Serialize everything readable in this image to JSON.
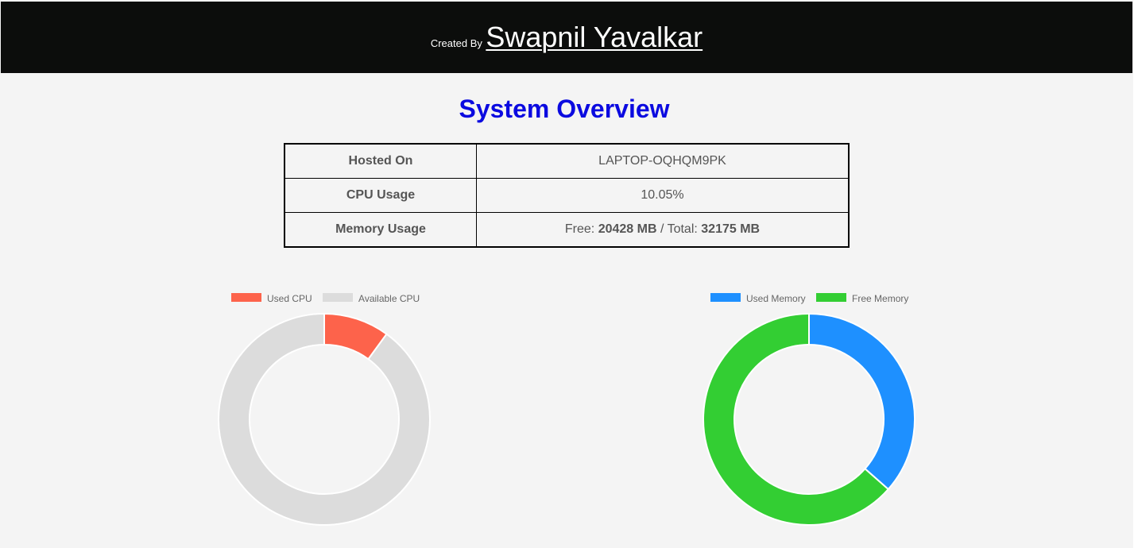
{
  "header": {
    "created_by": "Created By",
    "author": "Swapnil Yavalkar",
    "background": "#0c0d0c"
  },
  "page_title": "System Overview",
  "title_color": "#0b0ae0",
  "overview_table": {
    "rows": [
      {
        "label": "Hosted On",
        "value": "LAPTOP-OQHQM9PK"
      },
      {
        "label": "CPU Usage",
        "value": "10.05%"
      },
      {
        "label": "Memory Usage",
        "value_prefix": "Free: ",
        "free": "20428 MB",
        "separator": " / Total: ",
        "total": "32175 MB"
      }
    ]
  },
  "chart_data": [
    {
      "type": "pie",
      "variant": "doughnut",
      "legend_position": "top",
      "categories": [
        "Used CPU",
        "Available CPU"
      ],
      "values": [
        10.05,
        89.95
      ],
      "colors": [
        "#fd634b",
        "#dcdcdc"
      ]
    },
    {
      "type": "pie",
      "variant": "doughnut",
      "legend_position": "top",
      "categories": [
        "Used Memory",
        "Free Memory"
      ],
      "values": [
        11747,
        20428
      ],
      "colors": [
        "#1e90ff",
        "#33ce33"
      ]
    }
  ]
}
